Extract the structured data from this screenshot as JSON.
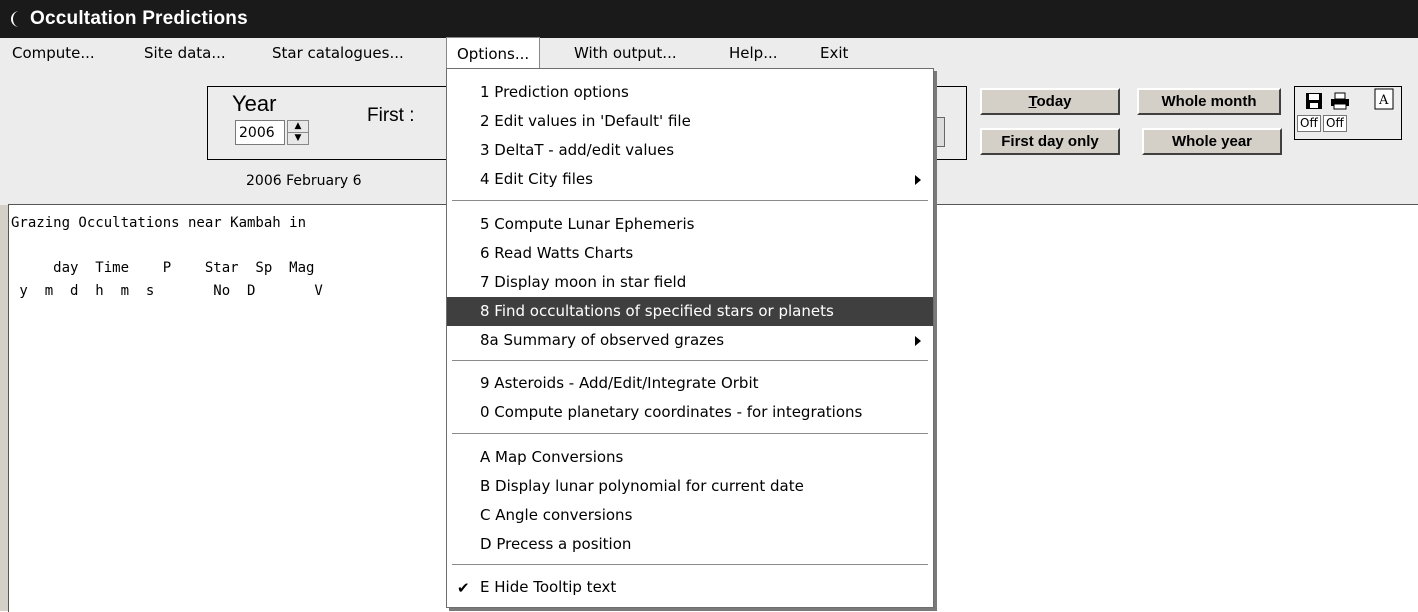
{
  "window": {
    "title": "Occultation Predictions"
  },
  "menubar": {
    "items": [
      "Compute...",
      "Site data...",
      "Star catalogues...",
      "Options...",
      "With output...",
      "Help...",
      "Exit"
    ]
  },
  "controls": {
    "year_label": "Year",
    "year_value": "2006",
    "first_label": "First :",
    "date_text": "2006 February 6",
    "today_label": "Today",
    "first_day_only_label": "First day only",
    "whole_month_label": "Whole month",
    "whole_year_label": "Whole year",
    "save_off": "Off",
    "print_off": "Off"
  },
  "output": {
    "line1": "Grazing Occultations near Kambah in",
    "line2": "     day  Time    P    Star  Sp  Mag",
    "line3": " y  m  d  h  m  s       No  D       V"
  },
  "options_menu": {
    "items": [
      "1 Prediction options",
      "2 Edit values in 'Default' file",
      "3 DeltaT - add/edit values",
      "4 Edit City files",
      "5 Compute Lunar Ephemeris",
      "6 Read Watts Charts",
      "7 Display moon in star field",
      "8 Find occultations of specified stars or planets",
      "8a Summary of observed grazes",
      "9 Asteroids - Add/Edit/Integrate Orbit",
      "0 Compute planetary coordinates - for integrations",
      "A Map Conversions",
      "B Display lunar polynomial for current date",
      "C Angle conversions",
      "D Precess a position",
      "E Hide Tooltip text"
    ],
    "selected_index": 7,
    "checked_item": "E Hide Tooltip text"
  }
}
